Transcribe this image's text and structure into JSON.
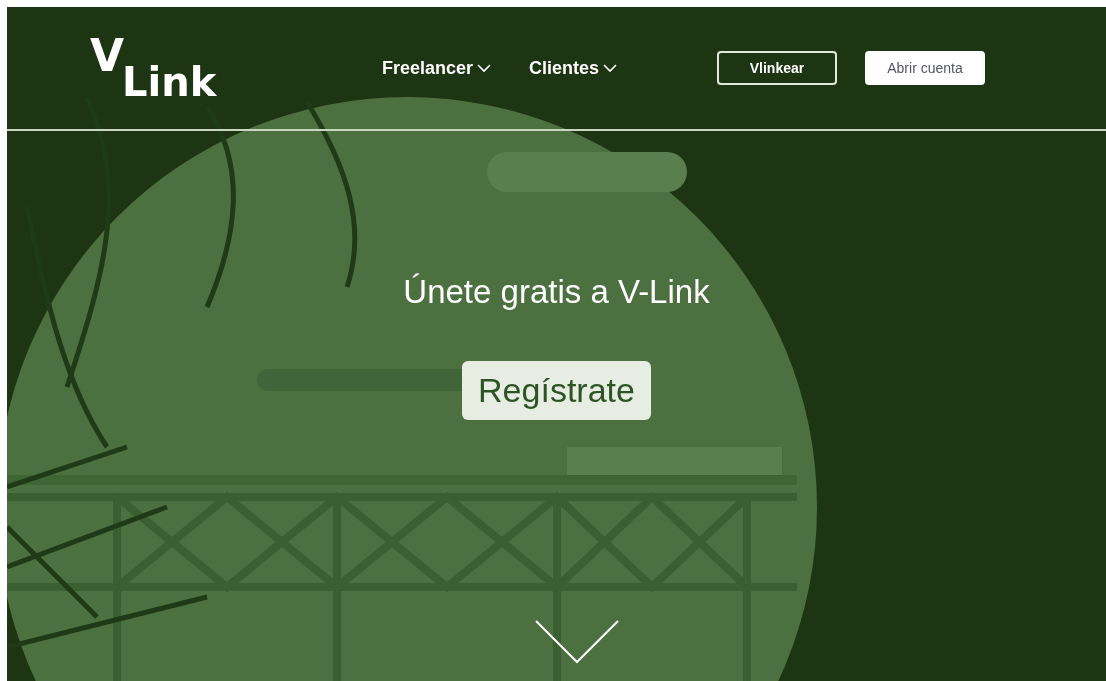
{
  "logo": {
    "mark": "V",
    "text": "Link"
  },
  "nav": [
    {
      "label": "Freelancer",
      "dropdown": true
    },
    {
      "label": "Clientes",
      "dropdown": true
    }
  ],
  "actions": [
    {
      "label": "Vlinkear",
      "kind": "outline"
    },
    {
      "label": "Abrir cuenta",
      "kind": "solid"
    }
  ],
  "hero": {
    "title": "Únete gratis a V-Link",
    "button": "Regístrate",
    "scroll_hint": true
  }
}
